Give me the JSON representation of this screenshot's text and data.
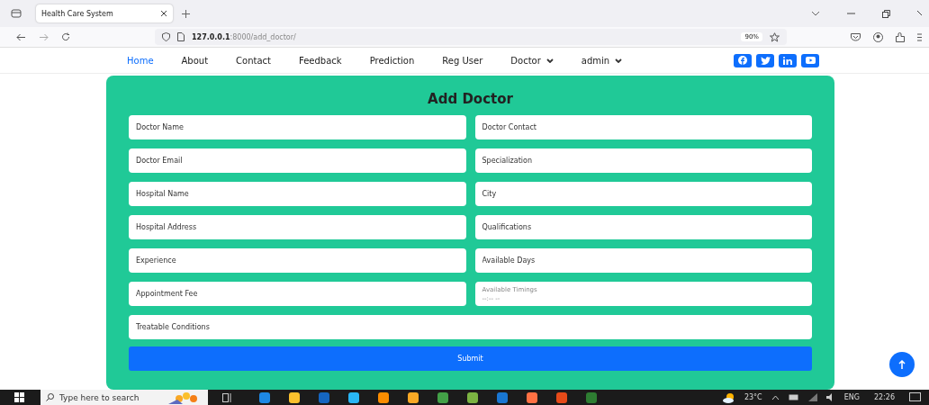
{
  "browser": {
    "tab": {
      "title": "Health Care System"
    },
    "url_host": "127.0.0.1",
    "url_path": ":8000/add_doctor/",
    "zoom": "90%"
  },
  "nav": {
    "items": [
      {
        "label": "Home",
        "selected": true,
        "dropdown": false
      },
      {
        "label": "About",
        "selected": false,
        "dropdown": false
      },
      {
        "label": "Contact",
        "selected": false,
        "dropdown": false
      },
      {
        "label": "Feedback",
        "selected": false,
        "dropdown": false
      },
      {
        "label": "Prediction",
        "selected": false,
        "dropdown": false
      },
      {
        "label": "Reg User",
        "selected": false,
        "dropdown": false
      },
      {
        "label": "Doctor",
        "selected": false,
        "dropdown": true
      },
      {
        "label": "admin",
        "selected": false,
        "dropdown": true
      }
    ],
    "social": [
      {
        "kind": "facebook"
      },
      {
        "kind": "twitter"
      },
      {
        "kind": "linkedin"
      },
      {
        "kind": "youtube"
      }
    ]
  },
  "form": {
    "title": "Add Doctor",
    "fields": [
      {
        "kind": "text",
        "placeholder": "Doctor Name"
      },
      {
        "kind": "text",
        "placeholder": "Doctor Contact"
      },
      {
        "kind": "text",
        "placeholder": "Doctor Email"
      },
      {
        "kind": "text",
        "placeholder": "Specialization"
      },
      {
        "kind": "text",
        "placeholder": "Hospital Name"
      },
      {
        "kind": "text",
        "placeholder": "City"
      },
      {
        "kind": "text",
        "placeholder": "Hospital Address"
      },
      {
        "kind": "text",
        "placeholder": "Qualifications"
      },
      {
        "kind": "text",
        "placeholder": "Experience"
      },
      {
        "kind": "text",
        "placeholder": "Available Days"
      },
      {
        "kind": "text",
        "placeholder": "Appointment Fee"
      },
      {
        "kind": "time",
        "label": "Available Timings",
        "placeholder": "--:-- --"
      },
      {
        "kind": "longtext",
        "placeholder": "Treatable Conditions"
      }
    ],
    "submit": "Submit"
  },
  "taskbar": {
    "search": "Type here to search",
    "weather": "23°C",
    "language": "ENG",
    "time": "22:26"
  }
}
